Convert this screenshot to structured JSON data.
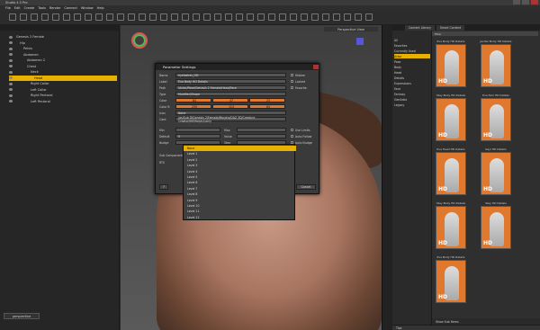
{
  "app": {
    "title": "Studio 4.5 Pro"
  },
  "menu": [
    "File",
    "Edit",
    "Create",
    "Tools",
    "Render",
    "Connect",
    "Window",
    "Help"
  ],
  "scene": {
    "rows": [
      {
        "label": "Genesis 2 Female",
        "indent": 0,
        "selected": false
      },
      {
        "label": "Hip",
        "indent": 1,
        "selected": false
      },
      {
        "label": "Pelvis",
        "indent": 2,
        "selected": false
      },
      {
        "label": "Abdomen",
        "indent": 2,
        "selected": false
      },
      {
        "label": "Abdomen 2",
        "indent": 3,
        "selected": false
      },
      {
        "label": "Chest",
        "indent": 3,
        "selected": false
      },
      {
        "label": "Neck",
        "indent": 4,
        "selected": false
      },
      {
        "label": "Head",
        "indent": 5,
        "selected": true
      },
      {
        "label": "Right Collar",
        "indent": 4,
        "selected": false
      },
      {
        "label": "Left Collar",
        "indent": 4,
        "selected": false
      },
      {
        "label": "Right Pectoral",
        "indent": 4,
        "selected": false
      },
      {
        "label": "Left Pectoral",
        "indent": 4,
        "selected": false
      }
    ],
    "footer_button": "perspective"
  },
  "viewport": {
    "label": "Perspective View"
  },
  "dialog": {
    "title": "Parameter Settings",
    "fields": [
      {
        "label": "Name",
        "value": "eyelashes_HD",
        "orange": false
      },
      {
        "label": "Label",
        "value": "Eva Body HD Details",
        "orange": false
      },
      {
        "label": "Path",
        "value": "/Actor/Pose/Genesis 2 Female/Head/Face",
        "orange": false
      },
      {
        "label": "Type",
        "value": "Modifier/Shape",
        "orange": false
      },
      {
        "label": "Color",
        "value": "",
        "orange": true
      },
      {
        "label": "Color B",
        "value": "",
        "orange": true
      },
      {
        "label": "Icon",
        "value": "None",
        "orange": false
      },
      {
        "label": "Card",
        "value": "/as/Sub DiGenesis 2/Female/Morphs/DAZ 3D/Creature Creator/HEMorph/Lonly",
        "orange": false
      }
    ],
    "color_values": [
      "84",
      "47",
      "23"
    ],
    "color_b_values": [
      "255",
      "124",
      "64"
    ],
    "min_label": "Min",
    "max_label": "Max",
    "default_label": "Default",
    "value_label": "Value",
    "nudge_label": "Nudge",
    "step_label": "Step",
    "sub_label": "Sub Components",
    "rts_label": "RTS",
    "checks": [
      "Hidden",
      "Locked",
      "Favorite",
      "Use Limits",
      "Auto Follow",
      "Auto Nudge"
    ],
    "default_value": "0",
    "accept": "Accept",
    "cancel": "Cancel"
  },
  "dropdown": {
    "items": [
      "None",
      "Level 1",
      "Level 2",
      "Level 3",
      "Level 4",
      "Level 5",
      "Level 6",
      "Level 7",
      "Level 8",
      "Level 9",
      "Level 10",
      "Level 11",
      "Level 12"
    ],
    "selected_index": 0
  },
  "content": {
    "tabs": [
      "Content Library",
      "Smart Content"
    ],
    "categories": [
      "All",
      "Favorites",
      "Currently Used",
      "Actor",
      "Pose",
      "Body",
      "Head",
      "Details",
      "Expressions",
      "Face",
      "Fantasy",
      "Genitalia",
      "Legacy"
    ],
    "selected_category": 3,
    "search_placeholder": "Filter",
    "thumbs": [
      {
        "label": "Eva Body HD Details"
      },
      {
        "label": "Jenifer Body HD Details"
      },
      {
        "label": "Stay Body HD Details"
      },
      {
        "label": "Eva Fem HD Details"
      },
      {
        "label": "Eva Head HD Details"
      },
      {
        "label": "Kayl HD Details"
      },
      {
        "label": "Stay Body HD Details"
      },
      {
        "label": "Stay HD Details"
      },
      {
        "label": "Eva Body HD Details"
      }
    ],
    "footer": "Show Sub Items",
    "bottom": "Tips"
  }
}
